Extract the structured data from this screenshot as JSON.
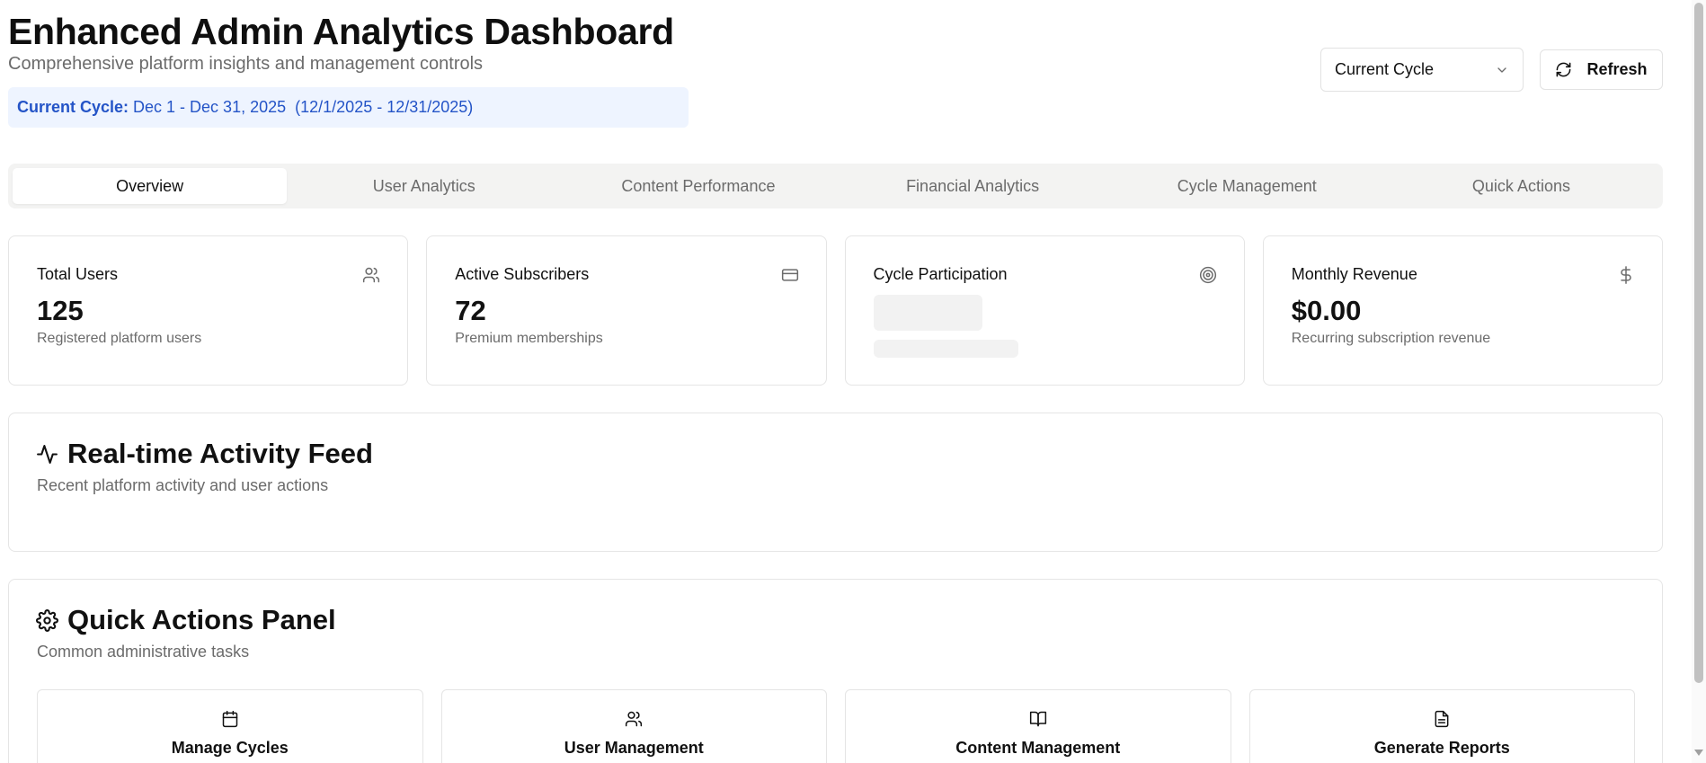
{
  "header": {
    "title": "Enhanced Admin Analytics Dashboard",
    "subtitle": "Comprehensive platform insights and management controls",
    "cycle_label": "Current Cycle:",
    "cycle_range": "Dec 1 - Dec 31, 2025",
    "cycle_dates": "(12/1/2025 - 12/31/2025)"
  },
  "controls": {
    "cycle_select_value": "Current Cycle",
    "refresh_label": "Refresh"
  },
  "tabs": [
    {
      "label": "Overview",
      "active": true
    },
    {
      "label": "User Analytics",
      "active": false
    },
    {
      "label": "Content Performance",
      "active": false
    },
    {
      "label": "Financial Analytics",
      "active": false
    },
    {
      "label": "Cycle Management",
      "active": false
    },
    {
      "label": "Quick Actions",
      "active": false
    }
  ],
  "stats": [
    {
      "label": "Total Users",
      "value": "125",
      "desc": "Registered platform users",
      "icon": "users-icon"
    },
    {
      "label": "Active Subscribers",
      "value": "72",
      "desc": "Premium memberships",
      "icon": "credit-card-icon"
    },
    {
      "label": "Cycle Participation",
      "value": null,
      "desc": null,
      "icon": "target-icon",
      "loading": true
    },
    {
      "label": "Monthly Revenue",
      "value": "$0.00",
      "desc": "Recurring subscription revenue",
      "icon": "dollar-icon"
    }
  ],
  "activity": {
    "title": "Real-time Activity Feed",
    "desc": "Recent platform activity and user actions",
    "icon": "activity-icon"
  },
  "quick_actions": {
    "title": "Quick Actions Panel",
    "desc": "Common administrative tasks",
    "icon": "gear-icon",
    "items": [
      {
        "label": "Manage Cycles",
        "icon": "calendar-icon"
      },
      {
        "label": "User Management",
        "icon": "users-icon"
      },
      {
        "label": "Content Management",
        "icon": "book-icon"
      },
      {
        "label": "Generate Reports",
        "icon": "file-text-icon"
      }
    ]
  },
  "colors": {
    "accent": "#2454c7",
    "banner_bg": "#eef4ff",
    "muted_text": "#6b6b6b",
    "border": "#e5e5e5"
  }
}
